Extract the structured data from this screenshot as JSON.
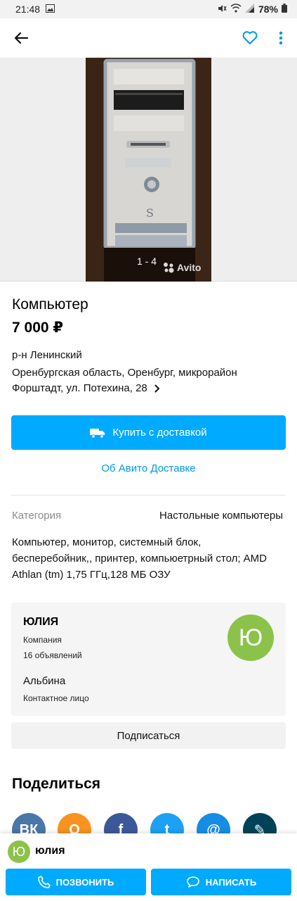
{
  "status_bar": {
    "time": "21:48",
    "battery": "78%",
    "icons": [
      "image-icon",
      "mute-icon",
      "wifi-icon",
      "signal-icon",
      "battery-icon"
    ]
  },
  "app_bar": {
    "icons": [
      "back-arrow-icon",
      "heart-icon",
      "more-vert-icon"
    ],
    "accent_color": "#0099e5"
  },
  "gallery": {
    "counter": "1 - 4",
    "watermark": "Avito"
  },
  "listing": {
    "title": "Компьютер",
    "price": "7 000 ₽",
    "district": "р-н Ленинский",
    "address": "Оренбургская область, Оренбург, микрорайон Форштадт, ул. Потехина, 28"
  },
  "actions": {
    "buy_label": "Купить с доставкой",
    "delivery_link": "Об Авито Доставке",
    "buy_color": "#00aaff"
  },
  "details": {
    "category_label": "Категория",
    "category_value": "Настольные компьютеры",
    "description": "Компьютер, монитор, системный блок, бесперебойник,, принтер, компьюетрный стол; AMD Athlan (tm) 1,75 ГГц,128 МБ ОЗУ"
  },
  "seller": {
    "name": "ЮЛИЯ",
    "type": "Компания",
    "ads_count": "16 объявлений",
    "contact_name": "Альбина",
    "contact_role": "Контактное лицо",
    "avatar_letter": "Ю",
    "avatar_color": "#8bc34a",
    "subscribe_label": "Подписаться"
  },
  "share": {
    "title": "Поделиться",
    "networks": [
      {
        "name": "vk-icon",
        "glyph": "ВК",
        "color": "#4a76a8"
      },
      {
        "name": "odnoklassniki-icon",
        "glyph": "О",
        "color": "#f7931e"
      },
      {
        "name": "facebook-icon",
        "glyph": "f",
        "color": "#3b5998"
      },
      {
        "name": "twitter-icon",
        "glyph": "t",
        "color": "#1da1f2"
      },
      {
        "name": "mail-ru-icon",
        "glyph": "@",
        "color": "#168de2"
      },
      {
        "name": "livejournal-icon",
        "glyph": "✎",
        "color": "#004359"
      }
    ]
  },
  "bottom_bar": {
    "name": "юлия",
    "avatar_letter": "Ю",
    "call_label": "ПОЗВОНИТЬ",
    "write_label": "НАПИСАТЬ"
  }
}
